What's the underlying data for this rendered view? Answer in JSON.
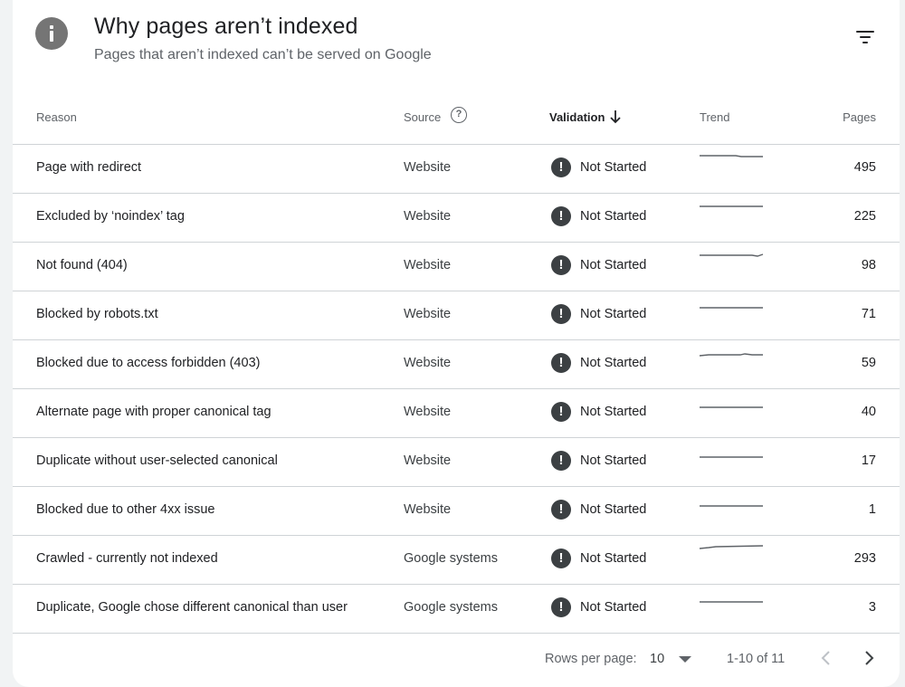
{
  "header": {
    "title": "Why pages aren’t indexed",
    "subtitle": "Pages that aren’t indexed can’t be served on Google"
  },
  "table": {
    "columns": {
      "reason": "Reason",
      "source": "Source",
      "validation": "Validation",
      "trend": "Trend",
      "pages": "Pages"
    },
    "rows": [
      {
        "reason": "Page with redirect",
        "source": "Website",
        "validation": "Not Started",
        "pages": "495"
      },
      {
        "reason": "Excluded by ‘noindex’ tag",
        "source": "Website",
        "validation": "Not Started",
        "pages": "225"
      },
      {
        "reason": "Not found (404)",
        "source": "Website",
        "validation": "Not Started",
        "pages": "98"
      },
      {
        "reason": "Blocked by robots.txt",
        "source": "Website",
        "validation": "Not Started",
        "pages": "71"
      },
      {
        "reason": "Blocked due to access forbidden (403)",
        "source": "Website",
        "validation": "Not Started",
        "pages": "59"
      },
      {
        "reason": "Alternate page with proper canonical tag",
        "source": "Website",
        "validation": "Not Started",
        "pages": "40"
      },
      {
        "reason": "Duplicate without user-selected canonical",
        "source": "Website",
        "validation": "Not Started",
        "pages": "17"
      },
      {
        "reason": "Blocked due to other 4xx issue",
        "source": "Website",
        "validation": "Not Started",
        "pages": "1"
      },
      {
        "reason": "Crawled - currently not indexed",
        "source": "Google systems",
        "validation": "Not Started",
        "pages": "293"
      },
      {
        "reason": "Duplicate, Google chose different canonical than user",
        "source": "Google systems",
        "validation": "Not Started",
        "pages": "3"
      }
    ]
  },
  "pagination": {
    "rows_per_page_label": "Rows per page:",
    "rows_per_page_value": "10",
    "range": "1-10 of 11"
  },
  "icons": {
    "header": "info-icon",
    "filter": "filter-icon",
    "help": "help-icon",
    "sort": "arrow-down-icon",
    "status": "exclamation-icon",
    "prev": "chevron-left-icon",
    "next": "chevron-right-icon"
  },
  "colors": {
    "status_icon": "#3c4043",
    "trend_line": "#5f6368",
    "header_icon": "#757575"
  }
}
